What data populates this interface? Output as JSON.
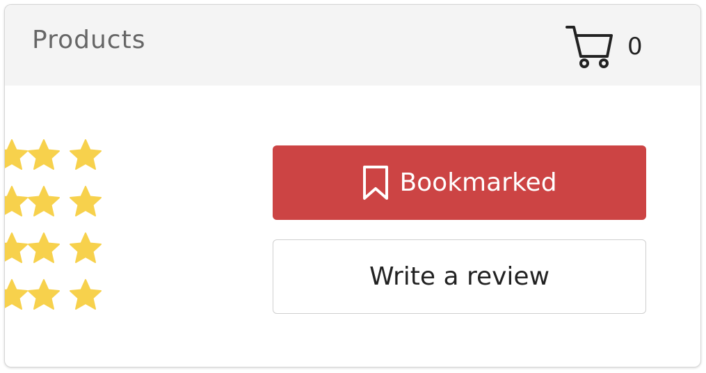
{
  "header": {
    "title": "Products",
    "cart_icon": "cart-icon",
    "cart_count": "0"
  },
  "rating": {
    "rows": 4,
    "icon": "star-icon",
    "color": "#f7d14c"
  },
  "actions": {
    "bookmark_label": "Bookmarked",
    "bookmark_icon": "bookmark-icon",
    "bookmark_color": "#cc4444",
    "review_label": "Write a review"
  }
}
